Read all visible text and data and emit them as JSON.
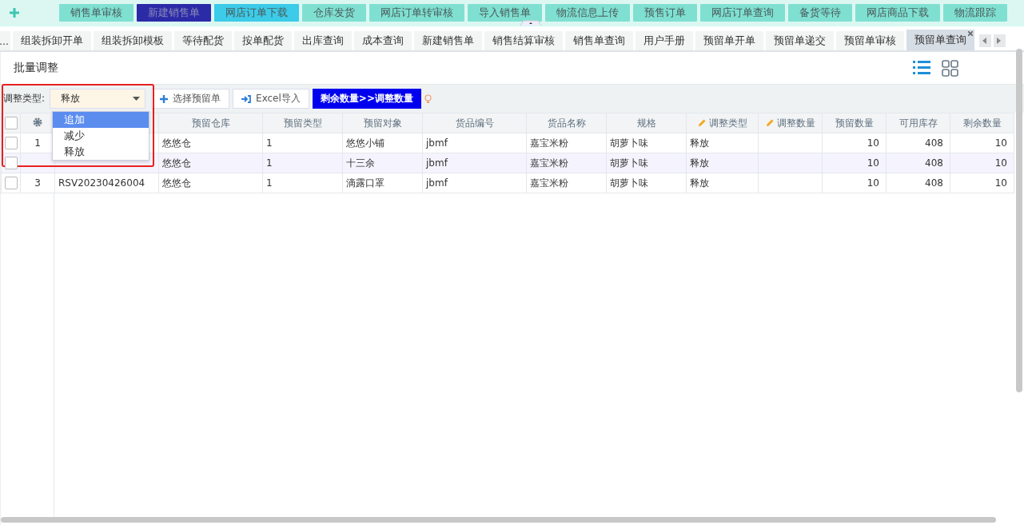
{
  "top_menu": [
    {
      "label": "销售单审核",
      "color": "#7fe0d2"
    },
    {
      "label": "新建销售单",
      "color": "#2b2ba8"
    },
    {
      "label": "网店订单下载",
      "color": "#3ccbe8"
    },
    {
      "label": "仓库发货",
      "color": "#7fe0d2"
    },
    {
      "label": "网店订单转审核",
      "color": "#7fe0d2"
    },
    {
      "label": "导入销售单",
      "color": "#7fe0d2"
    },
    {
      "label": "物流信息上传",
      "color": "#7fe0d2"
    },
    {
      "label": "预售订单",
      "color": "#7fe0d2"
    },
    {
      "label": "网店订单查询",
      "color": "#7fe0d2"
    },
    {
      "label": "备货等待",
      "color": "#7fe0d2"
    },
    {
      "label": "网店商品下载",
      "color": "#7fe0d2"
    },
    {
      "label": "物流跟踪",
      "color": "#7fe0d2"
    }
  ],
  "tabs": [
    {
      "label": "...",
      "selected": false
    },
    {
      "label": "组装拆卸开单",
      "selected": false
    },
    {
      "label": "组装拆卸模板",
      "selected": false
    },
    {
      "label": "等待配货",
      "selected": false
    },
    {
      "label": "按单配货",
      "selected": false
    },
    {
      "label": "出库查询",
      "selected": false
    },
    {
      "label": "成本查询",
      "selected": false
    },
    {
      "label": "新建销售单",
      "selected": false
    },
    {
      "label": "销售结算审核",
      "selected": false
    },
    {
      "label": "销售单查询",
      "selected": false
    },
    {
      "label": "用户手册",
      "selected": false
    },
    {
      "label": "预留单开单",
      "selected": false
    },
    {
      "label": "预留单递交",
      "selected": false
    },
    {
      "label": "预留单审核",
      "selected": false
    },
    {
      "label": "预留单查询",
      "selected": true
    }
  ],
  "page_title": "批量调整",
  "toolbar": {
    "type_label": "调整类型:",
    "type_value": "释放",
    "options": [
      {
        "label": "追加",
        "selected": true
      },
      {
        "label": "减少",
        "selected": false
      },
      {
        "label": "释放",
        "selected": false
      }
    ],
    "buttons": [
      "选择预留单",
      "Excel导入"
    ],
    "primary_button": "剩余数量>>调整数量"
  },
  "table": {
    "all_checked": false,
    "columns": [
      {
        "label": "预留仓库",
        "editable": false
      },
      {
        "label": "预留类型",
        "editable": false
      },
      {
        "label": "预留对象",
        "editable": false
      },
      {
        "label": "货品编号",
        "editable": false
      },
      {
        "label": "货品名称",
        "editable": false
      },
      {
        "label": "规格",
        "editable": false
      },
      {
        "label": "调整类型",
        "editable": true
      },
      {
        "label": "调整数量",
        "editable": true
      },
      {
        "label": "预留数量",
        "editable": false
      },
      {
        "label": "可用库存",
        "editable": false
      },
      {
        "label": "剩余数量",
        "editable": false
      }
    ],
    "rows": [
      {
        "index": "1",
        "checked": false,
        "highlighted": false,
        "cells": [
          "悠悠仓",
          "1",
          "悠悠小铺",
          "jbmf",
          "嘉宝米粉",
          "胡萝卜味",
          "释放",
          "",
          "10",
          "408",
          "10"
        ]
      },
      {
        "checked": false,
        "highlighted": true,
        "cells": [
          "悠悠仓",
          "1",
          "十三余",
          "jbmf",
          "嘉宝米粉",
          "胡萝卜味",
          "释放",
          "",
          "10",
          "408",
          "10"
        ]
      },
      {
        "index": "3",
        "checked": false,
        "highlighted": false,
        "doc_no": "RSV20230426004",
        "cells": [
          "悠悠仓",
          "1",
          "滴露口罩",
          "jbmf",
          "嘉宝米粉",
          "胡萝卜味",
          "释放",
          "",
          "10",
          "408",
          "10"
        ]
      }
    ]
  }
}
